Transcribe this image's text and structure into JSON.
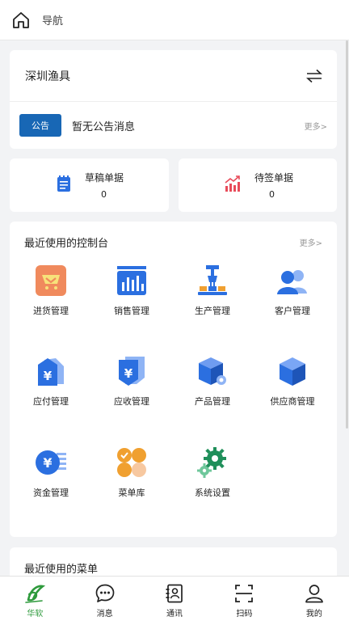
{
  "header": {
    "title": "导航"
  },
  "company": {
    "name": "深圳渔具"
  },
  "notice": {
    "badge": "公告",
    "text": "暂无公告消息",
    "more": "更多>"
  },
  "stats": [
    {
      "label": "草稿单据",
      "value": "0"
    },
    {
      "label": "待签单据",
      "value": "0"
    }
  ],
  "console": {
    "title": "最近使用的控制台",
    "more": "更多>",
    "items": [
      {
        "label": "进货管理",
        "icon": "purchase-cart-icon"
      },
      {
        "label": "销售管理",
        "icon": "sales-chart-icon"
      },
      {
        "label": "生产管理",
        "icon": "production-crane-icon"
      },
      {
        "label": "客户管理",
        "icon": "customers-icon"
      },
      {
        "label": "应付管理",
        "icon": "payable-yen-icon"
      },
      {
        "label": "应收管理",
        "icon": "receivable-yen-icon"
      },
      {
        "label": "产品管理",
        "icon": "product-box-icon"
      },
      {
        "label": "供应商管理",
        "icon": "supplier-cube-icon"
      },
      {
        "label": "资金管理",
        "icon": "funds-yen-icon"
      },
      {
        "label": "菜单库",
        "icon": "menu-library-icon"
      },
      {
        "label": "系统设置",
        "icon": "settings-gears-icon"
      }
    ]
  },
  "recent_menu": {
    "title": "最近使用的菜单"
  },
  "tabs": [
    {
      "label": "华软",
      "icon": "brand-logo-icon"
    },
    {
      "label": "消息",
      "icon": "message-bubble-icon"
    },
    {
      "label": "通讯",
      "icon": "contacts-book-icon"
    },
    {
      "label": "扫码",
      "icon": "scan-icon"
    },
    {
      "label": "我的",
      "icon": "profile-icon"
    }
  ],
  "colors": {
    "accent": "#1867b5",
    "icon_blue": "#2b6fe0",
    "active_tab": "#2e9a3c",
    "orange": "#f08a5d"
  }
}
